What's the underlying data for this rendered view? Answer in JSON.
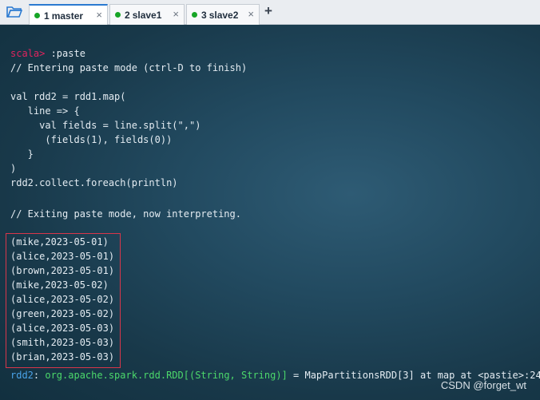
{
  "tabs": [
    {
      "num": "1",
      "name": "master",
      "close": "×"
    },
    {
      "num": "2",
      "name": "slave1",
      "close": "×"
    },
    {
      "num": "3",
      "name": "slave2",
      "close": "×"
    }
  ],
  "new_tab": "+",
  "terminal": {
    "prompt": "scala>",
    "command": " :paste",
    "lines": [
      "// Entering paste mode (ctrl-D to finish)",
      "val rdd2 = rdd1.map(",
      "   line => {",
      "     val fields = line.split(\",\")",
      "      (fields(1), fields(0))",
      "   }",
      ")",
      "rdd2.collect.foreach(println)",
      "// Exiting paste mode, now interpreting."
    ],
    "output": [
      "(mike,2023-05-01)",
      "(alice,2023-05-01)",
      "(brown,2023-05-01)",
      "(mike,2023-05-02)",
      "(alice,2023-05-02)",
      "(green,2023-05-02)",
      "(alice,2023-05-03)",
      "(smith,2023-05-03)",
      "(brian,2023-05-03)"
    ],
    "result_name": "rdd2",
    "result_sep": ": ",
    "result_type": "org.apache.spark.rdd.RDD[(String, String)]",
    "result_value": " = MapPartitionsRDD[3] at map at <pastie>:24"
  },
  "watermark": "CSDN @forget_wt"
}
